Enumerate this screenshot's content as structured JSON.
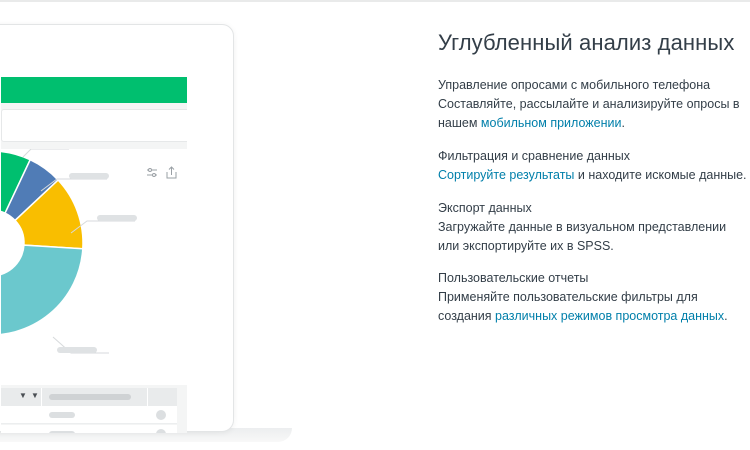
{
  "feature_section": {
    "heading": "Углубленный анализ данных",
    "items": [
      {
        "title": "Управление опросами с мобильного телефона",
        "desc_before": "Составляйте, рассылайте и анализируйте опросы в",
        "desc_line2_before": "нашем ",
        "link": "мобильном приложении",
        "desc_after": "."
      },
      {
        "title": "Фильтрация и сравнение данных",
        "link": "Сортируйте результаты",
        "desc_after": " и находите искомые данные."
      },
      {
        "title": "Экспорт данных",
        "desc_line1": "Загружайте данные в визуальном представлении",
        "desc_line2": "или экспортируйте их в SPSS."
      },
      {
        "title": "Пользовательские отчеты",
        "desc_line1": "Применяйте пользовательские фильтры для",
        "desc_line2_before": "создания ",
        "link": "различных режимов просмотра данных",
        "desc_after": "."
      }
    ]
  },
  "illustration": {
    "accent_color": "#00bf6f",
    "link_color": "#007faa",
    "chart_colors": [
      "#00bf6f",
      "#507cb6",
      "#f9be00",
      "#6bc8cd"
    ],
    "chart_shares": [
      0.16,
      0.06,
      0.13,
      0.26,
      0.39
    ],
    "chart_tool_icons": [
      "sliders-icon",
      "share-icon"
    ],
    "table_header_arrow": "▼",
    "table_row_count": 2
  }
}
